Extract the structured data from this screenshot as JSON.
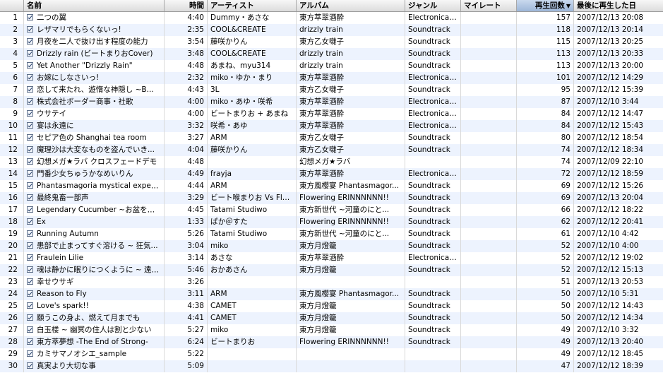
{
  "columns": {
    "num": "",
    "name": "名前",
    "time": "時間",
    "artist": "アーティスト",
    "album": "アルバム",
    "genre": "ジャンル",
    "rating": "マイレート",
    "plays": "再生回数",
    "last_played": "最後に再生した日"
  },
  "sort_icon": "sort-descending-icon",
  "rows": [
    {
      "num": "1",
      "name": "二つの翼",
      "time": "4:40",
      "artist": "Dummy・あさな",
      "album": "東方萃翠酒酔",
      "genre": "Electronica/...",
      "plays": "157",
      "last": "2007/12/13 20:08"
    },
    {
      "num": "2",
      "name": "レザマリでもらくないっ!",
      "time": "2:35",
      "artist": "COOL&CREATE",
      "album": "drizzly train",
      "genre": "Soundtrack",
      "plays": "118",
      "last": "2007/12/13 20:14"
    },
    {
      "num": "3",
      "name": "月夜を二人で抜け出す程度の能力",
      "time": "3:54",
      "artist": "藤咲かりん",
      "album": "東方乙女囃子",
      "genre": "Soundtrack",
      "plays": "115",
      "last": "2007/12/13 20:25"
    },
    {
      "num": "4",
      "name": "Drizzly rain (ビートまりおCover)",
      "time": "3:48",
      "artist": "COOL&CREATE",
      "album": "drizzly train",
      "genre": "Soundtrack",
      "plays": "113",
      "last": "2007/12/13 20:33"
    },
    {
      "num": "5",
      "name": "Yet Another \"Drizzly Rain\"",
      "time": "4:48",
      "artist": "あまね、myu314",
      "album": "drizzly train",
      "genre": "Soundtrack",
      "plays": "113",
      "last": "2007/12/13 20:00"
    },
    {
      "num": "6",
      "name": "お嫁にしなさいっ!",
      "time": "2:32",
      "artist": "miko・ゆか・まり",
      "album": "東方萃翠酒酔",
      "genre": "Electronica/...",
      "plays": "101",
      "last": "2007/12/12 14:29"
    },
    {
      "num": "7",
      "name": "恋して来たれ、遊惰な神隠し ~B...",
      "time": "4:43",
      "artist": "3L",
      "album": "東方乙女囃子",
      "genre": "Soundtrack",
      "plays": "95",
      "last": "2007/12/12 15:39"
    },
    {
      "num": "8",
      "name": "株式会社ボーダー商事・社歌",
      "time": "4:00",
      "artist": "miko・あゆ・咲希",
      "album": "東方萃翠酒酔",
      "genre": "Electronica/...",
      "plays": "87",
      "last": "2007/12/10 3:44"
    },
    {
      "num": "9",
      "name": "ウサテイ",
      "time": "4:00",
      "artist": "ビートまりお + あまね",
      "album": "東方萃翠酒酔",
      "genre": "Electronica/...",
      "plays": "84",
      "last": "2007/12/12 14:47"
    },
    {
      "num": "10",
      "name": "宴は永遠に",
      "time": "3:32",
      "artist": "咲希・あゆ",
      "album": "東方萃翠酒酔",
      "genre": "Electronica/...",
      "plays": "84",
      "last": "2007/12/12 15:43"
    },
    {
      "num": "11",
      "name": "セピア色の Shanghai tea room",
      "time": "3:27",
      "artist": "ARM",
      "album": "東方乙女囃子",
      "genre": "Soundtrack",
      "plays": "80",
      "last": "2007/12/12 18:54"
    },
    {
      "num": "12",
      "name": "魔理沙は大変なものを盗んでいき...",
      "time": "4:04",
      "artist": "藤咲かりん",
      "album": "東方乙女囃子",
      "genre": "Soundtrack",
      "plays": "74",
      "last": "2007/12/12 18:34"
    },
    {
      "num": "13",
      "name": "幻想メガ★ラバ クロスフェードデモ",
      "time": "4:48",
      "artist": "",
      "album": "幻想メガ★ラバ",
      "genre": "",
      "plays": "74",
      "last": "2007/12/09 22:10"
    },
    {
      "num": "14",
      "name": "門番少女ちゅうかなめいりん",
      "time": "4:49",
      "artist": "frayja",
      "album": "東方萃翠酒酔",
      "genre": "Electronica/...",
      "plays": "72",
      "last": "2007/12/12 18:59"
    },
    {
      "num": "15",
      "name": "Phantasmagoria mystical expectat...",
      "time": "4:44",
      "artist": "ARM",
      "album": "東方風櫻宴 Phantasmagor...",
      "genre": "Soundtrack",
      "plays": "69",
      "last": "2007/12/12 15:26"
    },
    {
      "num": "16",
      "name": "最終鬼畜一部声",
      "time": "3:29",
      "artist": "ビート喉まりお Vs Flo...",
      "album": "Flowering ERINNNNNN!!",
      "genre": "Soundtrack",
      "plays": "69",
      "last": "2007/12/13 20:04"
    },
    {
      "num": "17",
      "name": "Legendary Cucumber ~お盆を過...",
      "time": "4:45",
      "artist": "Tatami Studiwo",
      "album": "東方新世代 ~河童のにと...",
      "genre": "Soundtrack",
      "plays": "66",
      "last": "2007/12/12 18:22"
    },
    {
      "num": "18",
      "name": "Ex",
      "time": "1:33",
      "artist": "ぱか＠すた",
      "album": "Flowering ERINNNNNN!!",
      "genre": "Soundtrack",
      "plays": "62",
      "last": "2007/12/12 20:41"
    },
    {
      "num": "19",
      "name": "Running Autumn",
      "time": "5:26",
      "artist": "Tatami Studiwo",
      "album": "東方新世代 ~河童のにと...",
      "genre": "Soundtrack",
      "plays": "61",
      "last": "2007/12/10 4:42"
    },
    {
      "num": "20",
      "name": "患部で止まってすぐ溶ける ~ 狂気...",
      "time": "3:04",
      "artist": "miko",
      "album": "東方月燈籠",
      "genre": "Soundtrack",
      "plays": "52",
      "last": "2007/12/10 4:00"
    },
    {
      "num": "21",
      "name": "Fraulein Lilie",
      "time": "3:14",
      "artist": "あさな",
      "album": "東方萃翠酒酔",
      "genre": "Electronica/...",
      "plays": "52",
      "last": "2007/12/12 19:02"
    },
    {
      "num": "22",
      "name": "魂は静かに眠りにつくように ~ 遠野...",
      "time": "5:46",
      "artist": "おかあさん",
      "album": "東方月燈籠",
      "genre": "Soundtrack",
      "plays": "52",
      "last": "2007/12/12 15:13"
    },
    {
      "num": "23",
      "name": "幸せウサギ",
      "time": "3:26",
      "artist": "",
      "album": "",
      "genre": "",
      "plays": "51",
      "last": "2007/12/13 20:53"
    },
    {
      "num": "24",
      "name": "Reason to Fly",
      "time": "3:11",
      "artist": "ARM",
      "album": "東方風櫻宴 Phantasmagor...",
      "genre": "Soundtrack",
      "plays": "50",
      "last": "2007/12/10 5:31"
    },
    {
      "num": "25",
      "name": "Love's spark!!",
      "time": "4:38",
      "artist": "CAMET",
      "album": "東方月燈籠",
      "genre": "Soundtrack",
      "plays": "50",
      "last": "2007/12/12 14:43"
    },
    {
      "num": "26",
      "name": "願うこの身よ、燃えて月までも",
      "time": "4:41",
      "artist": "CAMET",
      "album": "東方月燈籠",
      "genre": "Soundtrack",
      "plays": "50",
      "last": "2007/12/12 14:34"
    },
    {
      "num": "27",
      "name": "白玉楼 ~ 幽冥の住人は割と少ない",
      "time": "5:27",
      "artist": "miko",
      "album": "東方月燈籠",
      "genre": "Soundtrack",
      "plays": "49",
      "last": "2007/12/10 3:32"
    },
    {
      "num": "28",
      "name": "東方萃夢想 -The End of Strong-",
      "time": "6:24",
      "artist": "ビートまりお",
      "album": "Flowering ERINNNNNN!!",
      "genre": "Soundtrack",
      "plays": "49",
      "last": "2007/12/13 20:40"
    },
    {
      "num": "29",
      "name": "カミサマノオシエ_sample",
      "time": "5:22",
      "artist": "",
      "album": "",
      "genre": "",
      "plays": "49",
      "last": "2007/12/12 18:45"
    },
    {
      "num": "30",
      "name": "真実より大切な事",
      "time": "5:09",
      "artist": "",
      "album": "",
      "genre": "",
      "plays": "47",
      "last": "2007/12/12 18:39"
    }
  ]
}
